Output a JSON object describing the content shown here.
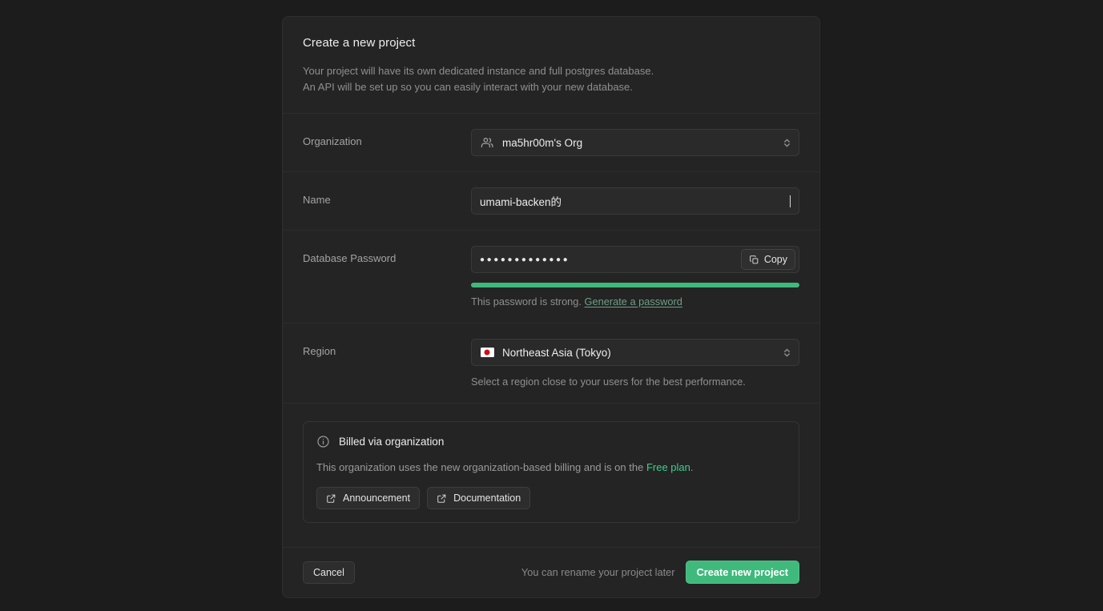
{
  "page": {
    "background": "#1c1c1c",
    "card_background": "#242424",
    "accent_green": "#3FB97C",
    "link_green": "#3ECF8E"
  },
  "header": {
    "title": "Create a new project",
    "subtitle_line1": "Your project will have its own dedicated instance and full postgres database.",
    "subtitle_line2": "An API will be set up so you can easily interact with your new database."
  },
  "organization": {
    "label": "Organization",
    "value": "ma5hr00m's Org",
    "icon": "users-icon",
    "selector_icon": "chevron-up-down-icon"
  },
  "name": {
    "label": "Name",
    "value": "umami-backen的",
    "placeholder": "Project name"
  },
  "password": {
    "label": "Database Password",
    "masked_value": "●●●●●●●●●●●●●",
    "copy_label": "Copy",
    "copy_icon": "copy-icon",
    "strength_percent": 100,
    "strength_color": "#3FB97C",
    "strength_text": "This password is strong.",
    "generate_link": "Generate a password"
  },
  "region": {
    "label": "Region",
    "value": "Northeast Asia (Tokyo)",
    "flag_icon": "japan-flag-icon",
    "helper": "Select a region close to your users for the best performance.",
    "selector_icon": "chevron-up-down-icon"
  },
  "billing": {
    "info_icon": "info-circle-icon",
    "title": "Billed via organization",
    "body_before_link": "This organization uses the new organization-based billing and is on the ",
    "link_text": "Free plan",
    "body_after_link": ".",
    "announcement_label": "Announcement",
    "documentation_label": "Documentation",
    "external_icon": "external-link-icon"
  },
  "footer": {
    "cancel_label": "Cancel",
    "note": "You can rename your project later",
    "submit_label": "Create new project"
  }
}
